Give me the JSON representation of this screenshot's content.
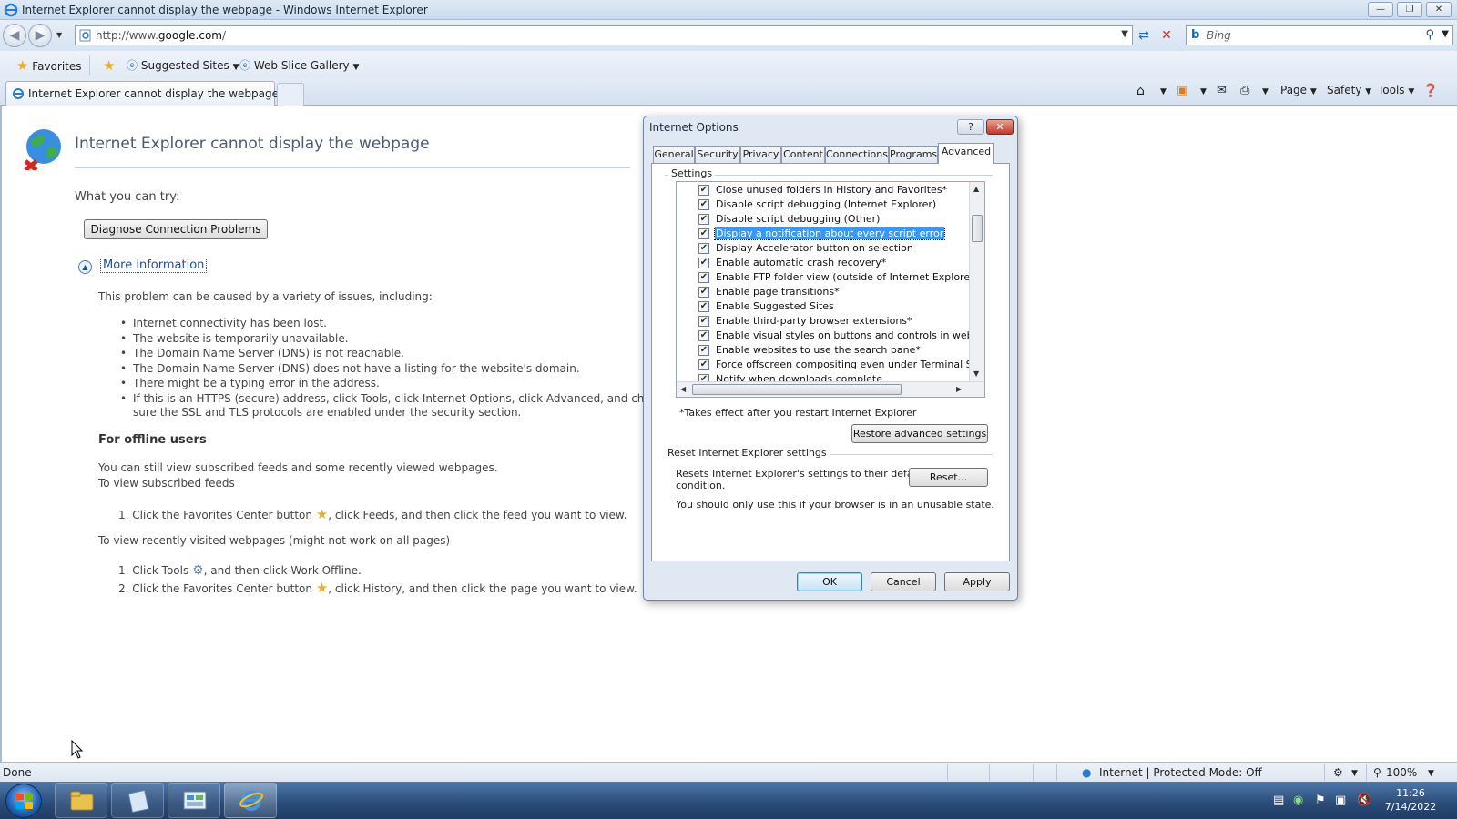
{
  "window": {
    "title": "Internet Explorer cannot display the webpage - Windows Internet Explorer",
    "minimize": "—",
    "restore": "❐",
    "close": "✕"
  },
  "address": {
    "url_prefix": "http://www.",
    "url_domain": "google.com",
    "url_suffix": "/",
    "search_placeholder": "Bing"
  },
  "favorites": {
    "favorites_label": "Favorites",
    "suggested_sites": "Suggested Sites",
    "web_slice_gallery": "Web Slice Gallery"
  },
  "tabs": {
    "active_tab": "Internet Explorer cannot display the webpage"
  },
  "command_bar": {
    "page": "Page",
    "safety": "Safety",
    "tools": "Tools"
  },
  "page": {
    "title": "Internet Explorer cannot display the webpage",
    "what_you_can_try": "What you can try:",
    "diagnose_button": "Diagnose Connection Problems",
    "more_information": "More information",
    "problem_intro": "This problem can be caused by a variety of issues, including:",
    "bullets": [
      "Internet connectivity has been lost.",
      "The website is temporarily unavailable.",
      "The Domain Name Server (DNS) is not reachable.",
      "The Domain Name Server (DNS) does not have a listing for the website's domain.",
      "There might be a typing error in the address.",
      "If this is an HTTPS (secure) address, click Tools, click Internet Options, click Advanced, and check to be",
      "sure the SSL and TLS protocols are enabled under the security section."
    ],
    "offline_heading": "For offline users",
    "offline_p1a": "You can still view subscribed feeds and some recently viewed webpages.",
    "offline_p1b": "To view subscribed feeds",
    "step_feeds_a": "1.  Click the Favorites Center button",
    "step_feeds_b": ", click Feeds, and then click the feed you want to view.",
    "offline_p2": "To view recently visited webpages (might not work on all pages)",
    "step_tools_a": "1.  Click Tools",
    "step_tools_b": ", and then click Work Offline.",
    "step_history_a": "2.  Click the Favorites Center button",
    "step_history_b": ", click History, and then click the page you want to view."
  },
  "dialog": {
    "title": "Internet Options",
    "help": "?",
    "close": "✕",
    "tabs": [
      "General",
      "Security",
      "Privacy",
      "Content",
      "Connections",
      "Programs",
      "Advanced"
    ],
    "active_tab": "Advanced",
    "settings_label": "Settings",
    "settings": [
      {
        "label": "Close unused folders in History and Favorites*",
        "checked": true
      },
      {
        "label": "Disable script debugging (Internet Explorer)",
        "checked": true
      },
      {
        "label": "Disable script debugging (Other)",
        "checked": true
      },
      {
        "label": "Display a notification about every script error",
        "checked": true,
        "selected": true
      },
      {
        "label": "Display Accelerator button on selection",
        "checked": true
      },
      {
        "label": "Enable automatic crash recovery*",
        "checked": true
      },
      {
        "label": "Enable FTP folder view (outside of Internet Explorer)",
        "checked": true
      },
      {
        "label": "Enable page transitions*",
        "checked": true
      },
      {
        "label": "Enable Suggested Sites",
        "checked": true
      },
      {
        "label": "Enable third-party browser extensions*",
        "checked": true
      },
      {
        "label": "Enable visual styles on buttons and controls in webpages",
        "checked": true
      },
      {
        "label": "Enable websites to use the search pane*",
        "checked": true
      },
      {
        "label": "Force offscreen compositing even under Terminal Server*",
        "checked": true
      },
      {
        "label": "Notify when downloads complete",
        "checked": true
      }
    ],
    "restart_note": "*Takes effect after you restart Internet Explorer",
    "restore_button": "Restore advanced settings",
    "reset_group": "Reset Internet Explorer settings",
    "reset_desc_1": "Resets Internet Explorer's settings to their default",
    "reset_desc_2": "condition.",
    "reset_button": "Reset...",
    "unusable_note": "You should only use this if your browser is in an unusable state.",
    "ok": "OK",
    "cancel": "Cancel",
    "apply": "Apply"
  },
  "status": {
    "left": "Done",
    "zone": "Internet | Protected Mode: Off",
    "zoom": "100%"
  },
  "taskbar": {
    "time": "11:26",
    "date": "7/14/2022"
  }
}
